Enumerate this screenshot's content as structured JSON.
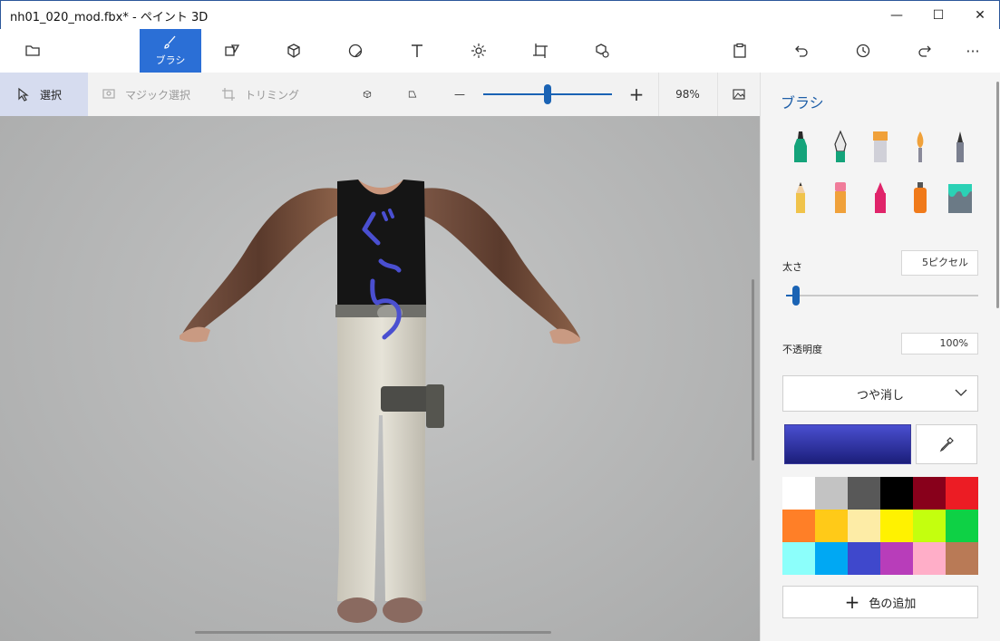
{
  "window": {
    "title": "nh01_020_mod.fbx* - ペイント 3D",
    "minimize_glyph": "—",
    "maximize_glyph": "☐",
    "close_glyph": "✕"
  },
  "toolbar": {
    "brush_label": "ブラシ",
    "more_glyph": "···"
  },
  "subbar": {
    "select_label": "選択",
    "magic_select_label": "マジック選択",
    "crop_label": "トリミング",
    "zoom_minus": "—",
    "zoom_plus": "+",
    "zoom_value": "98%",
    "zoom_level": 0.5
  },
  "panel": {
    "title": "ブラシ",
    "thickness_label": "太さ",
    "thickness_value": "5ピクセル",
    "thickness_level": 0.05,
    "opacity_label": "不透明度",
    "opacity_value": "100%",
    "finish_label": "つや消し",
    "current_color": "#4a4fd0",
    "add_color_label": "色の追加",
    "palette": [
      "#ffffff",
      "#c3c3c3",
      "#585858",
      "#000000",
      "#88001b",
      "#ec1c24",
      "#ff7f27",
      "#ffca18",
      "#fdeca6",
      "#fff200",
      "#c4ff0e",
      "#0ed145",
      "#8cfffb",
      "#00a8f3",
      "#3f48cc",
      "#b83dba",
      "#ffaec8",
      "#b97a56"
    ]
  },
  "canvas": {
    "annotation_text": "ぐら",
    "annotation_color": "#4a4fd0"
  },
  "icons": {
    "accent": "#2b6fd6"
  }
}
